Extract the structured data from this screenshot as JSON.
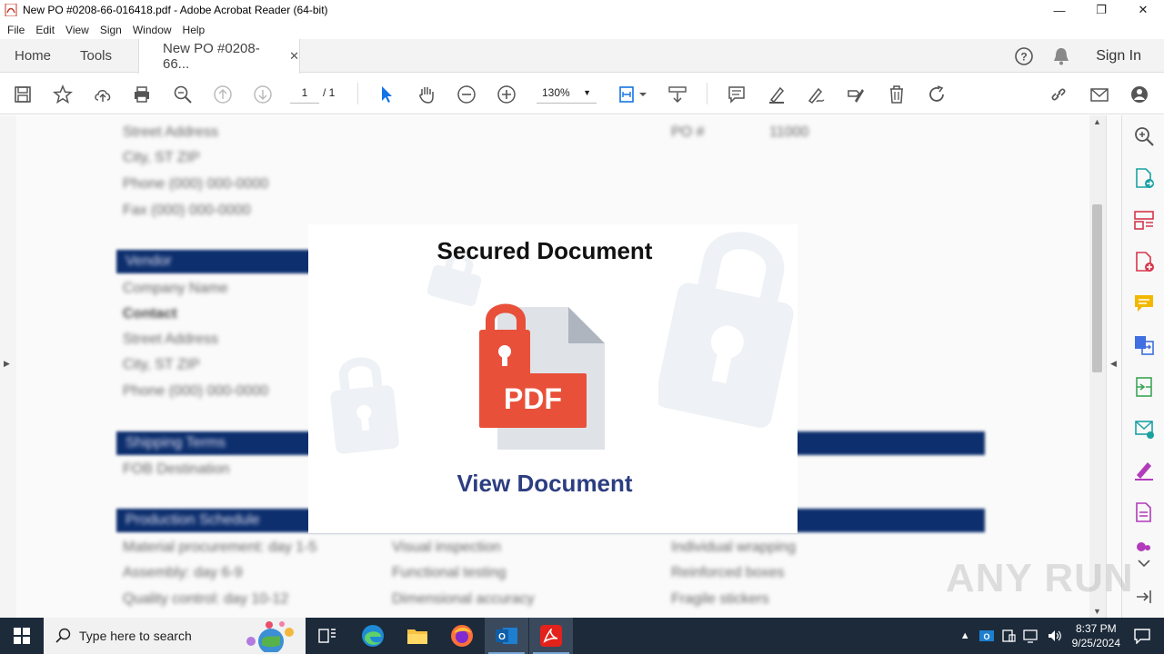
{
  "window": {
    "title": "New PO #0208-66-016418.pdf - Adobe Acrobat Reader (64-bit)",
    "min": "—",
    "max": "❐",
    "close": "✕"
  },
  "menu": [
    "File",
    "Edit",
    "View",
    "Sign",
    "Window",
    "Help"
  ],
  "tabs": {
    "home": "Home",
    "tools": "Tools",
    "document": "New PO #0208-66...",
    "close": "✕",
    "sign_in": "Sign In"
  },
  "toolbar": {
    "page_current": "1",
    "page_total": "/ 1",
    "zoom": "130%"
  },
  "document_bg": {
    "lines_left": [
      "Street Address",
      "City, ST ZIP",
      "Phone (000) 000-0000",
      "Fax (000) 000-0000"
    ],
    "lines_right": [
      "PO #",
      "11000"
    ],
    "vendor_header": "Vendor",
    "vendor_lines": [
      "Company Name",
      "Contact",
      "Street Address",
      "City, ST ZIP",
      "Phone (000) 000-0000"
    ],
    "shipping_header": "Shipping Terms",
    "shipping_line": "FOB Destination",
    "schedule_header": "Production Schedule",
    "schedule_rows": [
      [
        "Material procurement: day 1-5",
        "Visual inspection",
        "Individual wrapping"
      ],
      [
        "Assembly: day 6-9",
        "Functional testing",
        "Reinforced boxes"
      ],
      [
        "Quality control: day 10-12",
        "Dimensional accuracy",
        "Fragile stickers"
      ]
    ]
  },
  "modal": {
    "title": "Secured Document",
    "pdf_label": "PDF",
    "link": "View Document"
  },
  "watermark": "ANY RUN",
  "taskbar": {
    "search_placeholder": "Type here to search",
    "time": "8:37 PM",
    "date": "9/25/2024"
  },
  "colors": {
    "accent_blue": "#1473e6",
    "doc_header_blue": "#0d2f6e",
    "pdf_red": "#e8503a",
    "link_blue": "#2c3e80",
    "taskbar": "#1c2a3a"
  }
}
